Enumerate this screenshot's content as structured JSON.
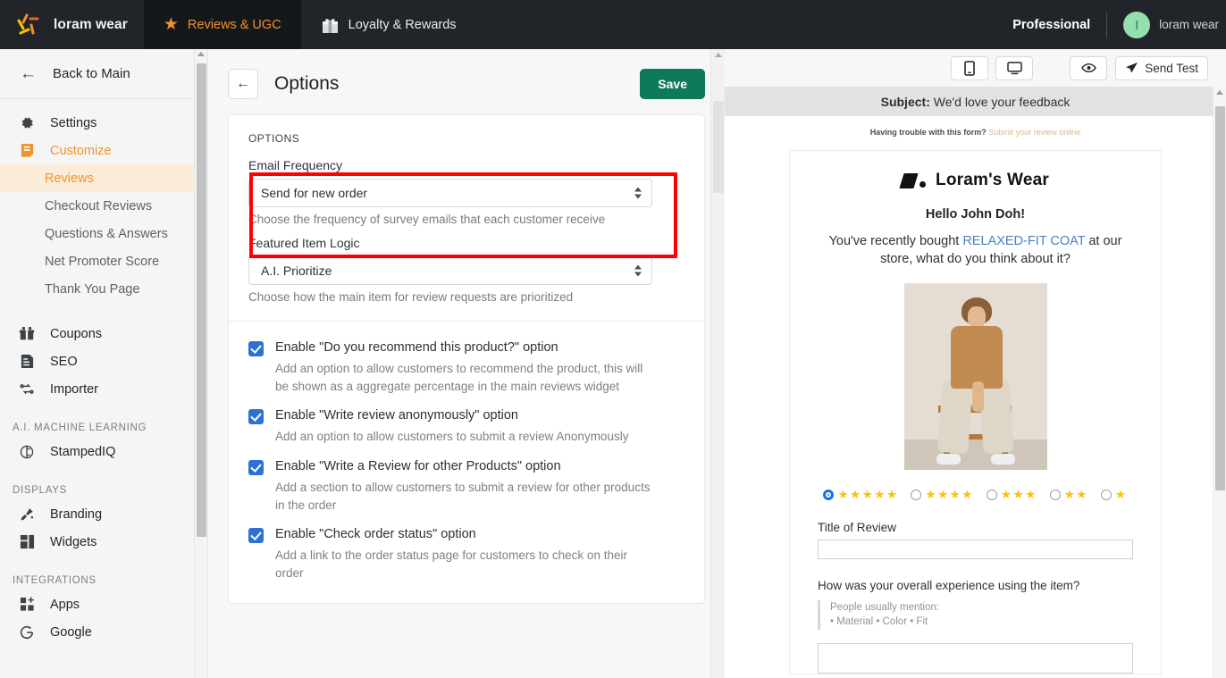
{
  "topbar": {
    "brand_name": "loram wear",
    "brand_logo_icon": "sparkle-logo-icon",
    "nav": [
      {
        "label": "Reviews & UGC",
        "icon": "star-icon",
        "active": true
      },
      {
        "label": "Loyalty & Rewards",
        "icon": "gift-icon",
        "active": false
      }
    ],
    "plan": "Professional",
    "avatar_initial": "l",
    "user_name": "loram wear"
  },
  "sidebar": {
    "back_label": "Back to Main",
    "back_icon": "arrow-left-icon",
    "items": [
      {
        "label": "Settings",
        "icon": "gear-icon"
      },
      {
        "label": "Customize",
        "icon": "customize-icon",
        "accent": true
      }
    ],
    "subitems": [
      {
        "label": "Reviews",
        "selected": true
      },
      {
        "label": "Checkout Reviews",
        "selected": false
      },
      {
        "label": "Questions & Answers",
        "selected": false
      },
      {
        "label": "Net Promoter Score",
        "selected": false
      },
      {
        "label": "Thank You Page",
        "selected": false
      }
    ],
    "items2": [
      {
        "label": "Coupons",
        "icon": "coupon-gift-icon"
      },
      {
        "label": "SEO",
        "icon": "seo-document-icon"
      },
      {
        "label": "Importer",
        "icon": "importer-sync-icon"
      }
    ],
    "group_ai": "A.I. MACHINE LEARNING",
    "items_ai": [
      {
        "label": "StampedIQ",
        "icon": "brain-icon"
      }
    ],
    "group_displays": "DISPLAYS",
    "items_displays": [
      {
        "label": "Branding",
        "icon": "paint-brush-icon"
      },
      {
        "label": "Widgets",
        "icon": "widgets-grid-icon"
      }
    ],
    "group_integrations": "INTEGRATIONS",
    "items_integrations": [
      {
        "label": "Apps",
        "icon": "apps-add-icon"
      },
      {
        "label": "Google",
        "icon": "google-g-icon"
      }
    ]
  },
  "main": {
    "back_icon": "arrow-left-icon",
    "title": "Options",
    "save_label": "Save",
    "card_label": "OPTIONS",
    "fields": [
      {
        "label": "Email Frequency",
        "value": "Send for new order",
        "help": "Choose the frequency of survey emails that each customer receive",
        "highlighted": true
      },
      {
        "label": "Featured Item Logic",
        "value": "A.I. Prioritize",
        "help": "Choose how the main item for review requests are prioritized",
        "highlighted": false
      }
    ],
    "checkboxes": [
      {
        "checked": true,
        "title": "Enable \"Do you recommend this product?\" option",
        "desc": "Add an option to allow customers to recommend the product, this will be shown as a aggregate percentage in the main reviews widget"
      },
      {
        "checked": true,
        "title": "Enable \"Write review anonymously\" option",
        "desc": "Add an option to allow customers to submit a review Anonymously"
      },
      {
        "checked": true,
        "title": "Enable \"Write a Review for other Products\" option",
        "desc": "Add a section to allow customers to submit a review for other products in the order"
      },
      {
        "checked": true,
        "title": "Enable \"Check order status\" option",
        "desc": "Add a link to the order status page for customers to check on their order"
      }
    ],
    "highlight_color": "#ff0000"
  },
  "preview": {
    "toolbar": {
      "mobile_icon": "mobile-device-icon",
      "desktop_icon": "desktop-monitor-icon",
      "eye_icon": "eye-preview-icon",
      "send_test_label": "Send Test",
      "send_test_icon": "paper-plane-icon"
    },
    "subject_label": "Subject",
    "subject_value": "We'd love your feedback",
    "trouble_text": "Having trouble with this form?",
    "trouble_link": "Submit your review online",
    "logo_text": "Loram's Wear",
    "hello": "Hello John Doh!",
    "intro_before": "You've recently bought ",
    "intro_product": "RELAXED-FIT COAT",
    "intro_after": " at our store, what do you think about it?",
    "product_image_alt": "man-in-tan-coat-photo",
    "ratings": [
      {
        "stars": 5,
        "selected": true
      },
      {
        "stars": 4,
        "selected": false
      },
      {
        "stars": 3,
        "selected": false
      },
      {
        "stars": 2,
        "selected": false
      },
      {
        "stars": 1,
        "selected": false
      }
    ],
    "title_label": "Title of Review",
    "title_value": "",
    "question_label": "How was your overall experience using the item?",
    "mention_heading": "People usually mention:",
    "mention_items": "• Material  • Color  • Fit",
    "review_value": ""
  },
  "colors": {
    "topbar_bg": "#212529",
    "accent_orange": "#f0932b",
    "save_green": "#0f7a5a",
    "checkbox_blue": "#2d72d2",
    "star_gold": "#ffc107",
    "highlight_red": "#ff0000"
  }
}
